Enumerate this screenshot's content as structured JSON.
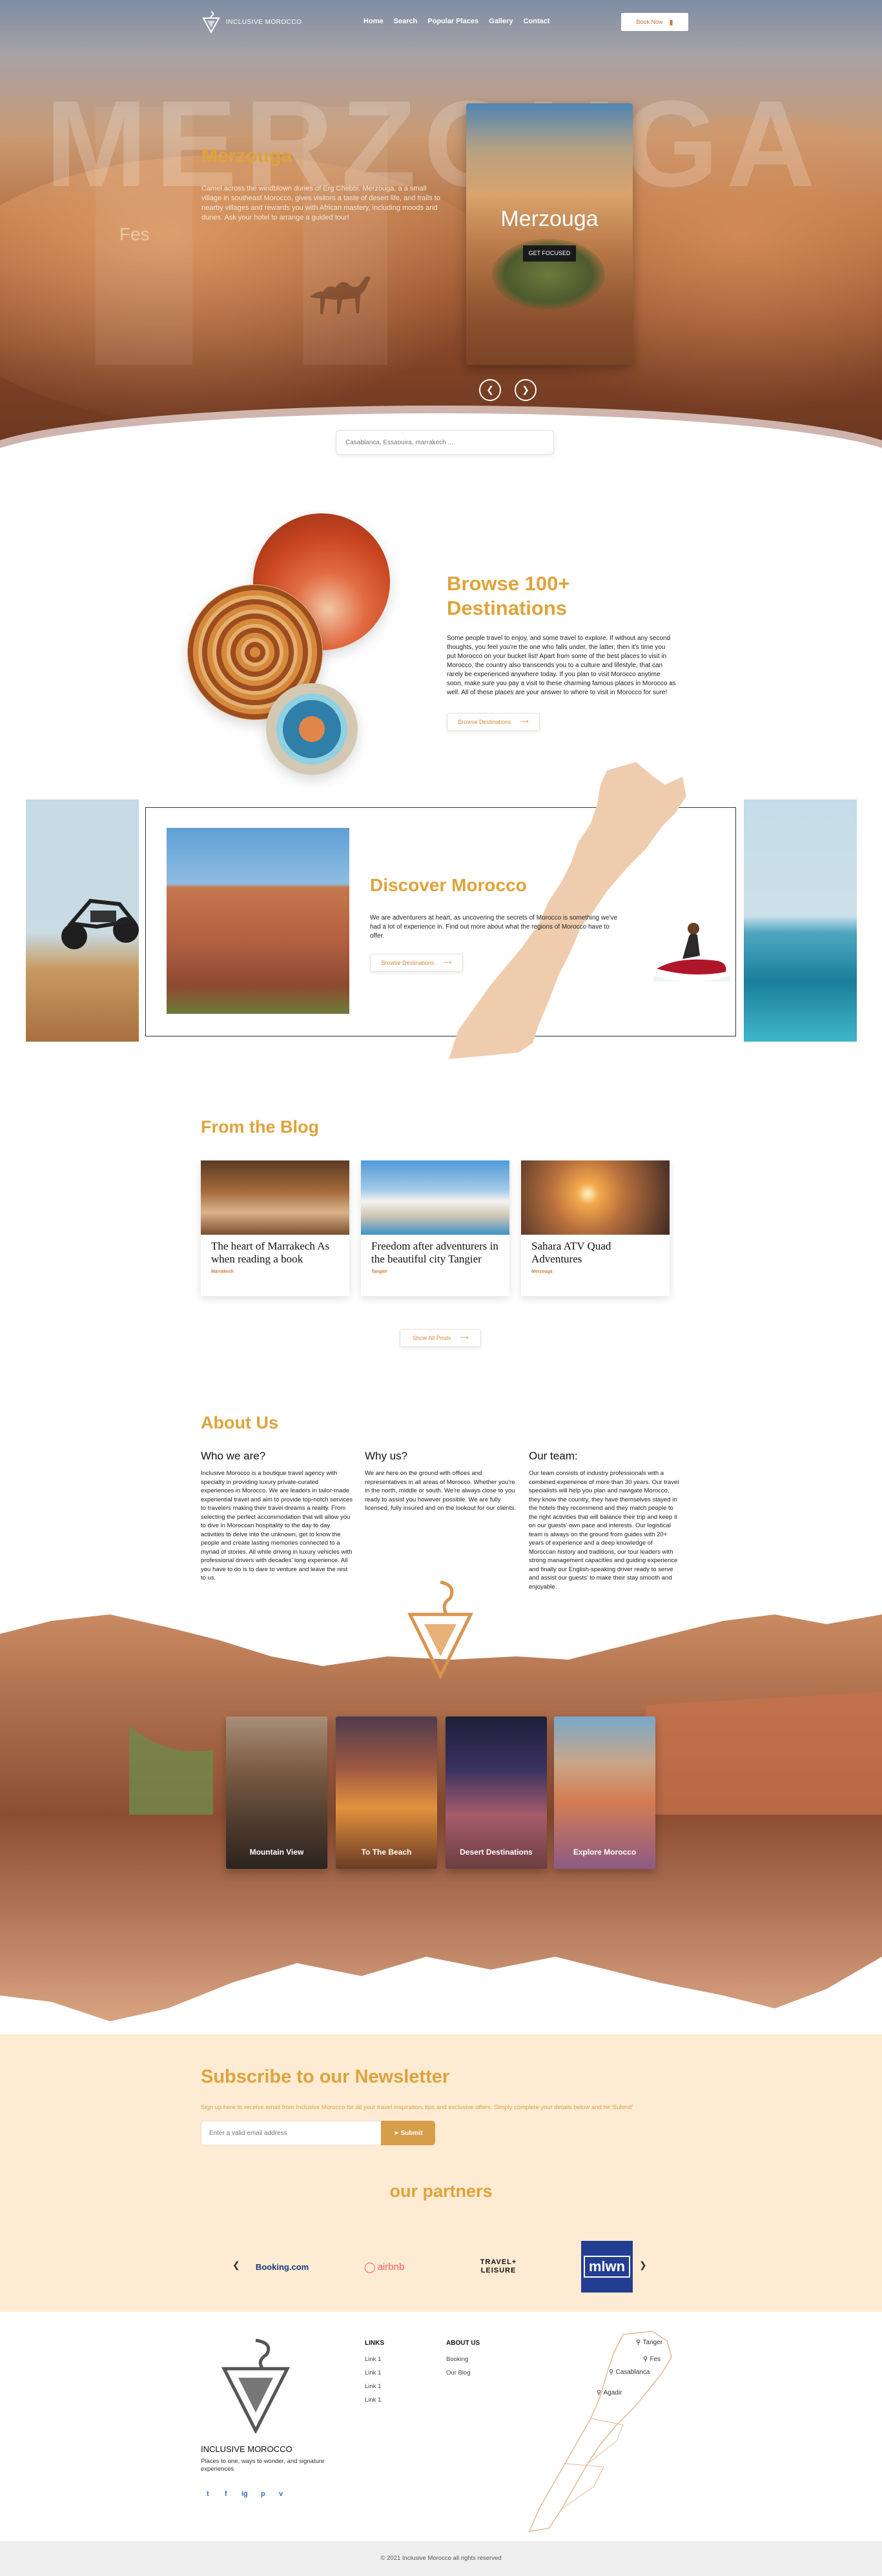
{
  "brand": {
    "name": "INCLUSIVE MOROCCO",
    "tagline": "Places to one, ways to wonder, and signature experiences"
  },
  "nav": {
    "links": [
      "Home",
      "Search",
      "Popular Places",
      "Gallery",
      "Contact"
    ],
    "book_label": "Book Now"
  },
  "hero": {
    "bg_word": "MERZOUGA",
    "side_label": "Fes",
    "title": "Merzouga",
    "description": "Camel across the windblown dunes of Erg Chebbi. Merzouga, a a small village in southeast Morocco, gives visitors a taste of desert life, and trails to nearby villages and rewards you with African mastery, including moods and dunes. Ask your hotel to arrange a guided tour!",
    "card_title": "Merzouga",
    "card_button": "GET FOCUSED",
    "prev_icon": "chevron-left-icon",
    "next_icon": "chevron-right-icon"
  },
  "search": {
    "placeholder": "Casablanca, Essaouira, marrakech ..."
  },
  "browse": {
    "title": "Browse 100+ Destinations",
    "text": "Some people travel to enjoy, and some travel to explore. If without any second thoughts, you feel you're the one who falls under, the latter, then it's time you put Morocco on your bucket list! Apart from some of the best places to visit in Morocco, the country also transcends you to a culture and lifestyle, that can rarely be experienced anywhere today. If you plan to visit Morocco anytime soon, make sure you pay a visit to these charming famous places in Morocco as well. All of these places are your answer to where to visit in Morocco for sure!",
    "button": "Browse Destinations"
  },
  "discover": {
    "title": "Discover Morocco",
    "text": "We are adventurers at heart, as uncovering the secrets of Morocco is something we've had a lot of experience in. Find out more about what the regions of Morocco have to offer.",
    "button": "Browse Destinations"
  },
  "blog": {
    "title": "From the Blog",
    "posts": [
      {
        "title": "The heart of Marrakech As when reading a book",
        "tag": "Marrakesh"
      },
      {
        "title": "Freedom after adventurers in the beautiful city Tangier",
        "tag": "Tangier"
      },
      {
        "title": "Sahara ATV Quad Adventures",
        "tag": "Merzouga"
      }
    ],
    "button": "Show All Posts"
  },
  "about": {
    "title": "About Us",
    "columns": [
      {
        "heading": "Who we are?",
        "text": "Inclusive Morocco is a boutique travel agency with specialty in providing luxury private-curated experiences in Morocco. We are leaders in tailor-made experiential travel and aim to provide top-notch services to travelers making their travel dreams a reality. From selecting the perfect accommodation that will allow you to dive in Moroccan hospitality to the day to day activities to delve into the unknown, get to know the people and create lasting memories connected to a myriad of stories. All while driving in luxury vehicles with professional drivers with decades' long experience. All you have to do is to dare to venture and leave the rest to us."
      },
      {
        "heading": "Why us?",
        "text": "We are here on the ground with offices and representatives in all areas of Morocco. Whether you're in the north, middle or south. We're always close to you ready to assist you however possible. We are fully licensed, fully insured and on the lookout for our clients."
      },
      {
        "heading": "Our team:",
        "text": "Our team consists of industry professionals with a combined experience of more than 30 years. Our travel specialists will help you plan and navigate Morocco, they know the country, they have themselves stayed in the hotels they recommend and they match people to the right activities that will balance their trip and keep it on our guests' own pace and interests. Our logistical team is always on the ground from guides with 20+ years of experience and a deep knowledge of Moroccan history and traditions, our tour leaders with strong management capacities and guiding experience and finally our English-speaking driver ready to serve and assist our guests' to make their stay smooth and enjoyable."
      }
    ]
  },
  "experiences": [
    {
      "label": "Mountain View"
    },
    {
      "label": "To The Beach"
    },
    {
      "label": "Desert Destinations"
    },
    {
      "label": "Explore Morocco"
    }
  ],
  "newsletter": {
    "title": "Subscribe to our Newsletter",
    "subtitle": "Sign up here to receive email from Inclusive Morocco for all your travel inspiration, tips and exclusive offers. Simply complete your details below and hit 'Submit'",
    "placeholder": "Enter a valid email address",
    "button": "Submit"
  },
  "partners": {
    "title": "our partners",
    "items": [
      "Booking.com",
      "airbnb",
      "TRAVEL+ LEISURE",
      "mlwn"
    ]
  },
  "footer": {
    "links_heading": "LINKS",
    "links": [
      "Link 1",
      "Link 1",
      "Link 1",
      "Link 1"
    ],
    "about_heading": "ABOUT US",
    "about_links": [
      "Booking",
      "Our Blog"
    ],
    "map_cities": [
      "Tanger",
      "Fes",
      "Casablanca",
      "Agadir"
    ],
    "social": [
      "t",
      "f",
      "ig",
      "p",
      "v"
    ],
    "copyright": "© 2021 Inclusive Morocco all rights reserved"
  },
  "colors": {
    "accent": "#dea33a",
    "newsletter_bg": "#fdebd3",
    "map_fill": "#f0ccae"
  }
}
